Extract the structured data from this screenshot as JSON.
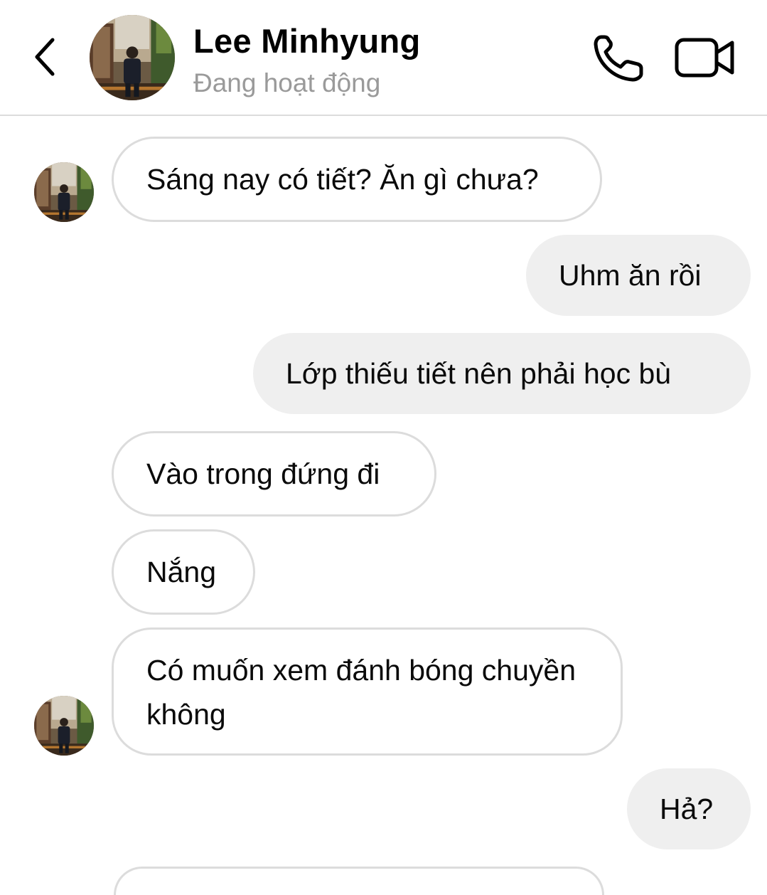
{
  "header": {
    "back_icon": "chevron-left-icon",
    "contact_name": "Lee Minhyung",
    "status": "Đang hoạt động",
    "call_icon": "phone-icon",
    "video_icon": "video-camera-icon"
  },
  "messages": [
    {
      "direction": "incoming",
      "text": "Sáng nay có tiết? Ăn gì chưa?"
    },
    {
      "direction": "outgoing",
      "text": "Uhm ăn rồi"
    },
    {
      "direction": "outgoing",
      "text": "Lớp thiếu tiết nên phải học bù"
    },
    {
      "direction": "incoming",
      "text": "Vào trong đứng đi"
    },
    {
      "direction": "incoming",
      "text": "Nắng"
    },
    {
      "direction": "incoming",
      "text": "Có muốn xem đánh bóng chuyền không"
    },
    {
      "direction": "outgoing",
      "text": "Hả?"
    }
  ],
  "colors": {
    "incoming_bubble_border": "#dcdcdc",
    "outgoing_bubble_bg": "#efefef",
    "status_text": "#9a9a9a"
  }
}
